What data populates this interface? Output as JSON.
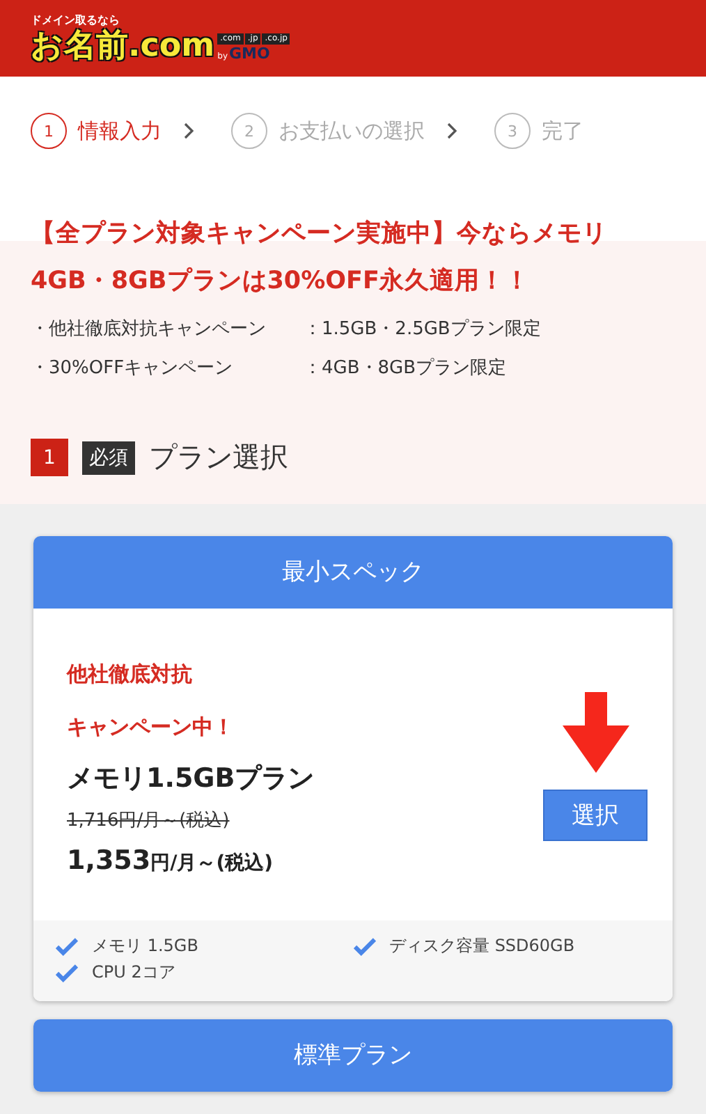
{
  "header": {
    "tagline": "ドメイン取るなら",
    "logo": "お名前.com",
    "tlds": [
      ".com",
      ".jp",
      ".co.jp"
    ],
    "by": "by",
    "company": "GMO"
  },
  "steps": [
    {
      "number": "1",
      "label": "情報入力",
      "selected": true
    },
    {
      "number": "2",
      "label": "お支払いの選択",
      "selected": false
    },
    {
      "number": "3",
      "label": "完了",
      "selected": false
    }
  ],
  "campaign": {
    "headline": "【全プラン対象キャンペーン実施中】今ならメモリ4GB・8GBプランは30%OFF永久適用！！",
    "notes": [
      {
        "name": "・他社徹底対抗キャンペーン",
        "value": "：1.5GB・2.5GBプラン限定"
      },
      {
        "name": "・30%OFFキャンペーン",
        "value": "：4GB・8GBプラン限定"
      }
    ]
  },
  "section": {
    "number": "1",
    "badge": "必須",
    "title": "プラン選択"
  },
  "plans": [
    {
      "title": "最小スペック",
      "campaign": [
        "他社徹底対抗",
        "キャンペーン中！"
      ],
      "name": "メモリ1.5GBプラン",
      "old_price": "1,716円/月～(税込)",
      "price": "1,353",
      "price_unit": "円/月～(税込)",
      "button": "選択",
      "arrow": true,
      "features": [
        "メモリ 1.5GB",
        "ディスク容量 SSD60GB",
        "CPU 2コア"
      ]
    },
    {
      "title": "標準プラン"
    }
  ]
}
